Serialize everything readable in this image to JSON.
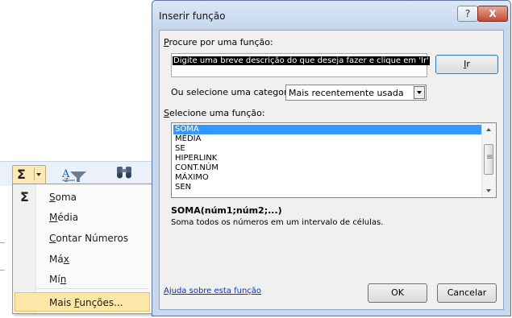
{
  "menu": {
    "autosum_symbol": "Σ",
    "items": [
      {
        "label": "Soma",
        "key_index": 0,
        "icon": "Σ"
      },
      {
        "label": "Média",
        "key_index": 0,
        "icon": ""
      },
      {
        "label": "Contar Números",
        "key_index": 0,
        "icon": ""
      },
      {
        "label": "Máx",
        "key_index": 2,
        "icon": ""
      },
      {
        "label": "Mín",
        "key_index": 2,
        "icon": ""
      },
      {
        "label": "Mais Funções...",
        "key_index": 5,
        "icon": ""
      }
    ],
    "highlight_color": "#fce7a8"
  },
  "dialog": {
    "title": "Inserir função",
    "help_label": "?",
    "close_label": "X",
    "search_label": "Procure por uma função:",
    "search_value": "Digite uma breve descrição do que deseja fazer e clique em 'Ir'",
    "go_label": "Ir",
    "category_label": "Ou selecione uma categoria:",
    "category_value": "Mais recentemente usada",
    "function_label": "Selecione uma função:",
    "functions": [
      "SOMA",
      "MÉDIA",
      "SE",
      "HIPERLINK",
      "CONT.NÚM",
      "MÁXIMO",
      "SEN"
    ],
    "selected_function": "SOMA",
    "syntax": "SOMA(núm1;núm2;...)",
    "description": "Soma todos os números em um intervalo de células.",
    "help_link": "Ajuda sobre esta função",
    "ok_label": "OK",
    "cancel_label": "Cancelar",
    "selection_color": "#3399ff"
  }
}
